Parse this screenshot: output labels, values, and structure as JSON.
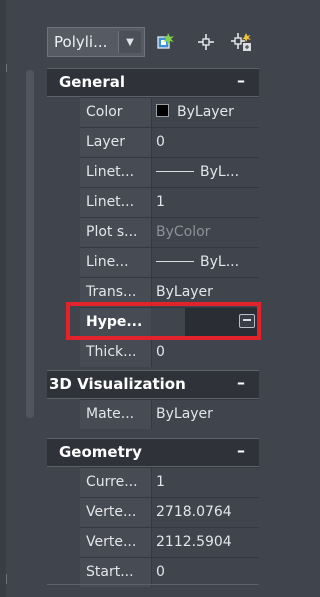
{
  "toolbar": {
    "object_type": "Polyli...",
    "icons": [
      "quick-select-icon",
      "select-objects-icon",
      "toggle-pickadd-icon"
    ]
  },
  "sections": [
    {
      "title": "General",
      "toggle": "–",
      "rows": [
        {
          "name": "Color",
          "value": "ByLayer"
        },
        {
          "name": "Layer",
          "value": "0"
        },
        {
          "name": "Linet...",
          "value": "ByL..."
        },
        {
          "name": "Linet...",
          "value": "1"
        },
        {
          "name": "Plot s...",
          "value": "ByColor"
        },
        {
          "name": "Line...",
          "value": "ByL..."
        },
        {
          "name": "Trans...",
          "value": "ByLayer"
        },
        {
          "name": "Hype...",
          "value": ""
        },
        {
          "name": "Thick...",
          "value": "0"
        }
      ]
    },
    {
      "title": "3D Visualization",
      "toggle": "–",
      "rows": [
        {
          "name": "Mate...",
          "value": "ByLayer"
        }
      ]
    },
    {
      "title": "Geometry",
      "toggle": "–",
      "rows": [
        {
          "name": "Curre...",
          "value": "1"
        },
        {
          "name": "Verte...",
          "value": "2718.0764"
        },
        {
          "name": "Verte...",
          "value": "2112.5904"
        },
        {
          "name": "Start...",
          "value": "0"
        }
      ]
    }
  ],
  "colors": {
    "panel_bg": "#40444c",
    "section_bg": "#2f3239",
    "highlight": "#e2232b"
  }
}
